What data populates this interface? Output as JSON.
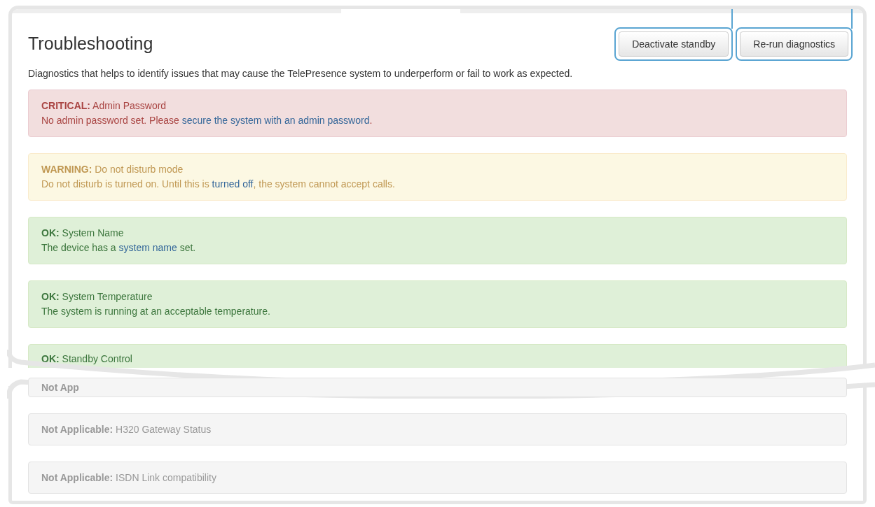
{
  "header": {
    "title": "Troubleshooting",
    "buttons": [
      {
        "label": "Deactivate standby",
        "highlighted": true
      },
      {
        "label": "Re-run diagnostics",
        "highlighted": true
      }
    ]
  },
  "description": "Diagnostics that helps to identify issues that may cause the TelePresence system to underperform or fail to work as expected.",
  "alerts": [
    {
      "kind": "critical",
      "status": "CRITICAL:",
      "title": "Admin Password",
      "before": "No admin password set. Please ",
      "link": "secure the system with an admin password",
      "after": "."
    },
    {
      "kind": "warning",
      "status": "WARNING:",
      "title": "Do not disturb mode",
      "before": "Do not disturb is turned on. Until this is ",
      "link": "turned off",
      "after": ", the system cannot accept calls."
    },
    {
      "kind": "ok",
      "status": "OK:",
      "title": "System Name",
      "before": "The device has a ",
      "link": "system name",
      "after": " set."
    },
    {
      "kind": "ok",
      "status": "OK:",
      "title": "System Temperature",
      "before": "The system is running at an acceptable temperature."
    },
    {
      "kind": "ok",
      "status": "OK:",
      "title": "Standby Control"
    }
  ],
  "lower_alerts": [
    {
      "status": "Not App"
    },
    {
      "status": "Not Applicable:",
      "title": "H320 Gateway Status"
    },
    {
      "status": "Not Applicable:",
      "title": "ISDN Link compatibility"
    }
  ]
}
